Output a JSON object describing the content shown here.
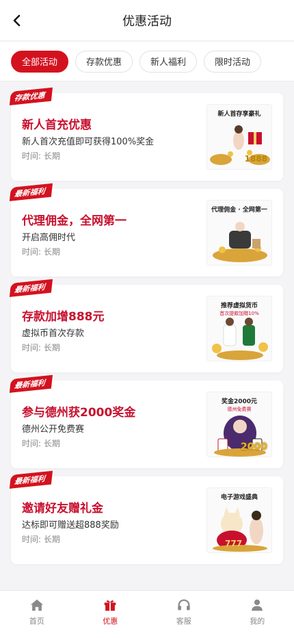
{
  "header": {
    "title": "优惠活动"
  },
  "tabs": [
    {
      "label": "全部活动",
      "active": true
    },
    {
      "label": "存款优惠",
      "active": false
    },
    {
      "label": "新人福利",
      "active": false
    },
    {
      "label": "限时活动",
      "active": false
    }
  ],
  "promos": [
    {
      "ribbon": "存款优惠",
      "title": "新人首充优惠",
      "desc": "新人首次充值即可获得100%奖金",
      "time": "时间: 长期",
      "thumb_head": "新人首存享豪礼",
      "thumb_sub": "",
      "thumb_num": "1888"
    },
    {
      "ribbon": "最新福利",
      "title": "代理佣金，全网第一",
      "desc": "开启高佣时代",
      "time": "时间: 长期",
      "thumb_head": "代理佣金 · 全网第一",
      "thumb_sub": "",
      "thumb_num": ""
    },
    {
      "ribbon": "最新福利",
      "title": "存款加增888元",
      "desc": "虚拟币首次存款",
      "time": "时间: 长期",
      "thumb_head": "推荐虚拟货币",
      "thumb_sub": "首次提款加赠10%",
      "thumb_num": ""
    },
    {
      "ribbon": "最新福利",
      "title": "参与德州获2000奖金",
      "desc": "德州公开免费赛",
      "time": "时间: 长期",
      "thumb_head": "奖金2000元",
      "thumb_sub": "德州免费赛",
      "thumb_num": "2000"
    },
    {
      "ribbon": "最新福利",
      "title": "邀请好友赠礼金",
      "desc": "达标即可赠送超888奖励",
      "time": "时间: 长期",
      "thumb_head": "电子游戏盛典",
      "thumb_sub": "",
      "thumb_num": "777"
    }
  ],
  "nav": [
    {
      "label": "首页",
      "icon": "home-icon",
      "active": false
    },
    {
      "label": "优惠",
      "icon": "gift-icon",
      "active": true
    },
    {
      "label": "客服",
      "icon": "headset-icon",
      "active": false
    },
    {
      "label": "我的",
      "icon": "user-icon",
      "active": false
    }
  ],
  "colors": {
    "accent": "#d4121f",
    "title_red": "#c8102e",
    "gold": "#d9a43a"
  }
}
